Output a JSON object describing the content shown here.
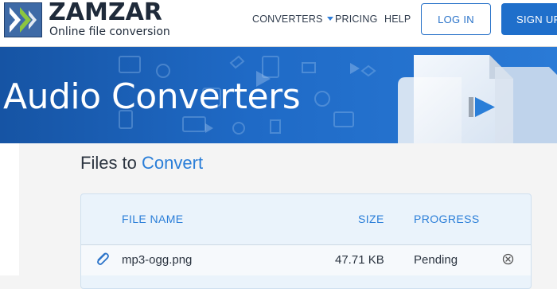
{
  "header": {
    "logo_name": "ZAMZAR",
    "logo_tm": "™",
    "logo_tagline": "Online file conversion",
    "nav": {
      "converters": "CONVERTERS",
      "pricing": "PRICING",
      "help": "HELP"
    },
    "login_label": "LOG IN",
    "signup_label": "SIGN UP"
  },
  "banner": {
    "title": "Audio Converters"
  },
  "files": {
    "title_prefix": "Files to",
    "title_accent": "Convert",
    "columns": {
      "file_name": "FILE NAME",
      "size": "SIZE",
      "progress": "PROGRESS"
    },
    "rows": [
      {
        "file_name": "mp3-ogg.png",
        "size": "47.71 KB",
        "progress": "Pending"
      }
    ]
  },
  "icons": {
    "logo": "zamzar-chevrons-icon",
    "dropdown": "chevron-down-icon",
    "attachment": "paperclip-icon",
    "remove": "remove-circle-icon",
    "banner_media": "play-icon"
  },
  "colors": {
    "brand_blue": "#1f6fcb",
    "accent_blue": "#2a7ed8",
    "banner_blue": "#1f6ac6",
    "logo_green": "#8cc63f",
    "text_dark": "#2b3440"
  }
}
